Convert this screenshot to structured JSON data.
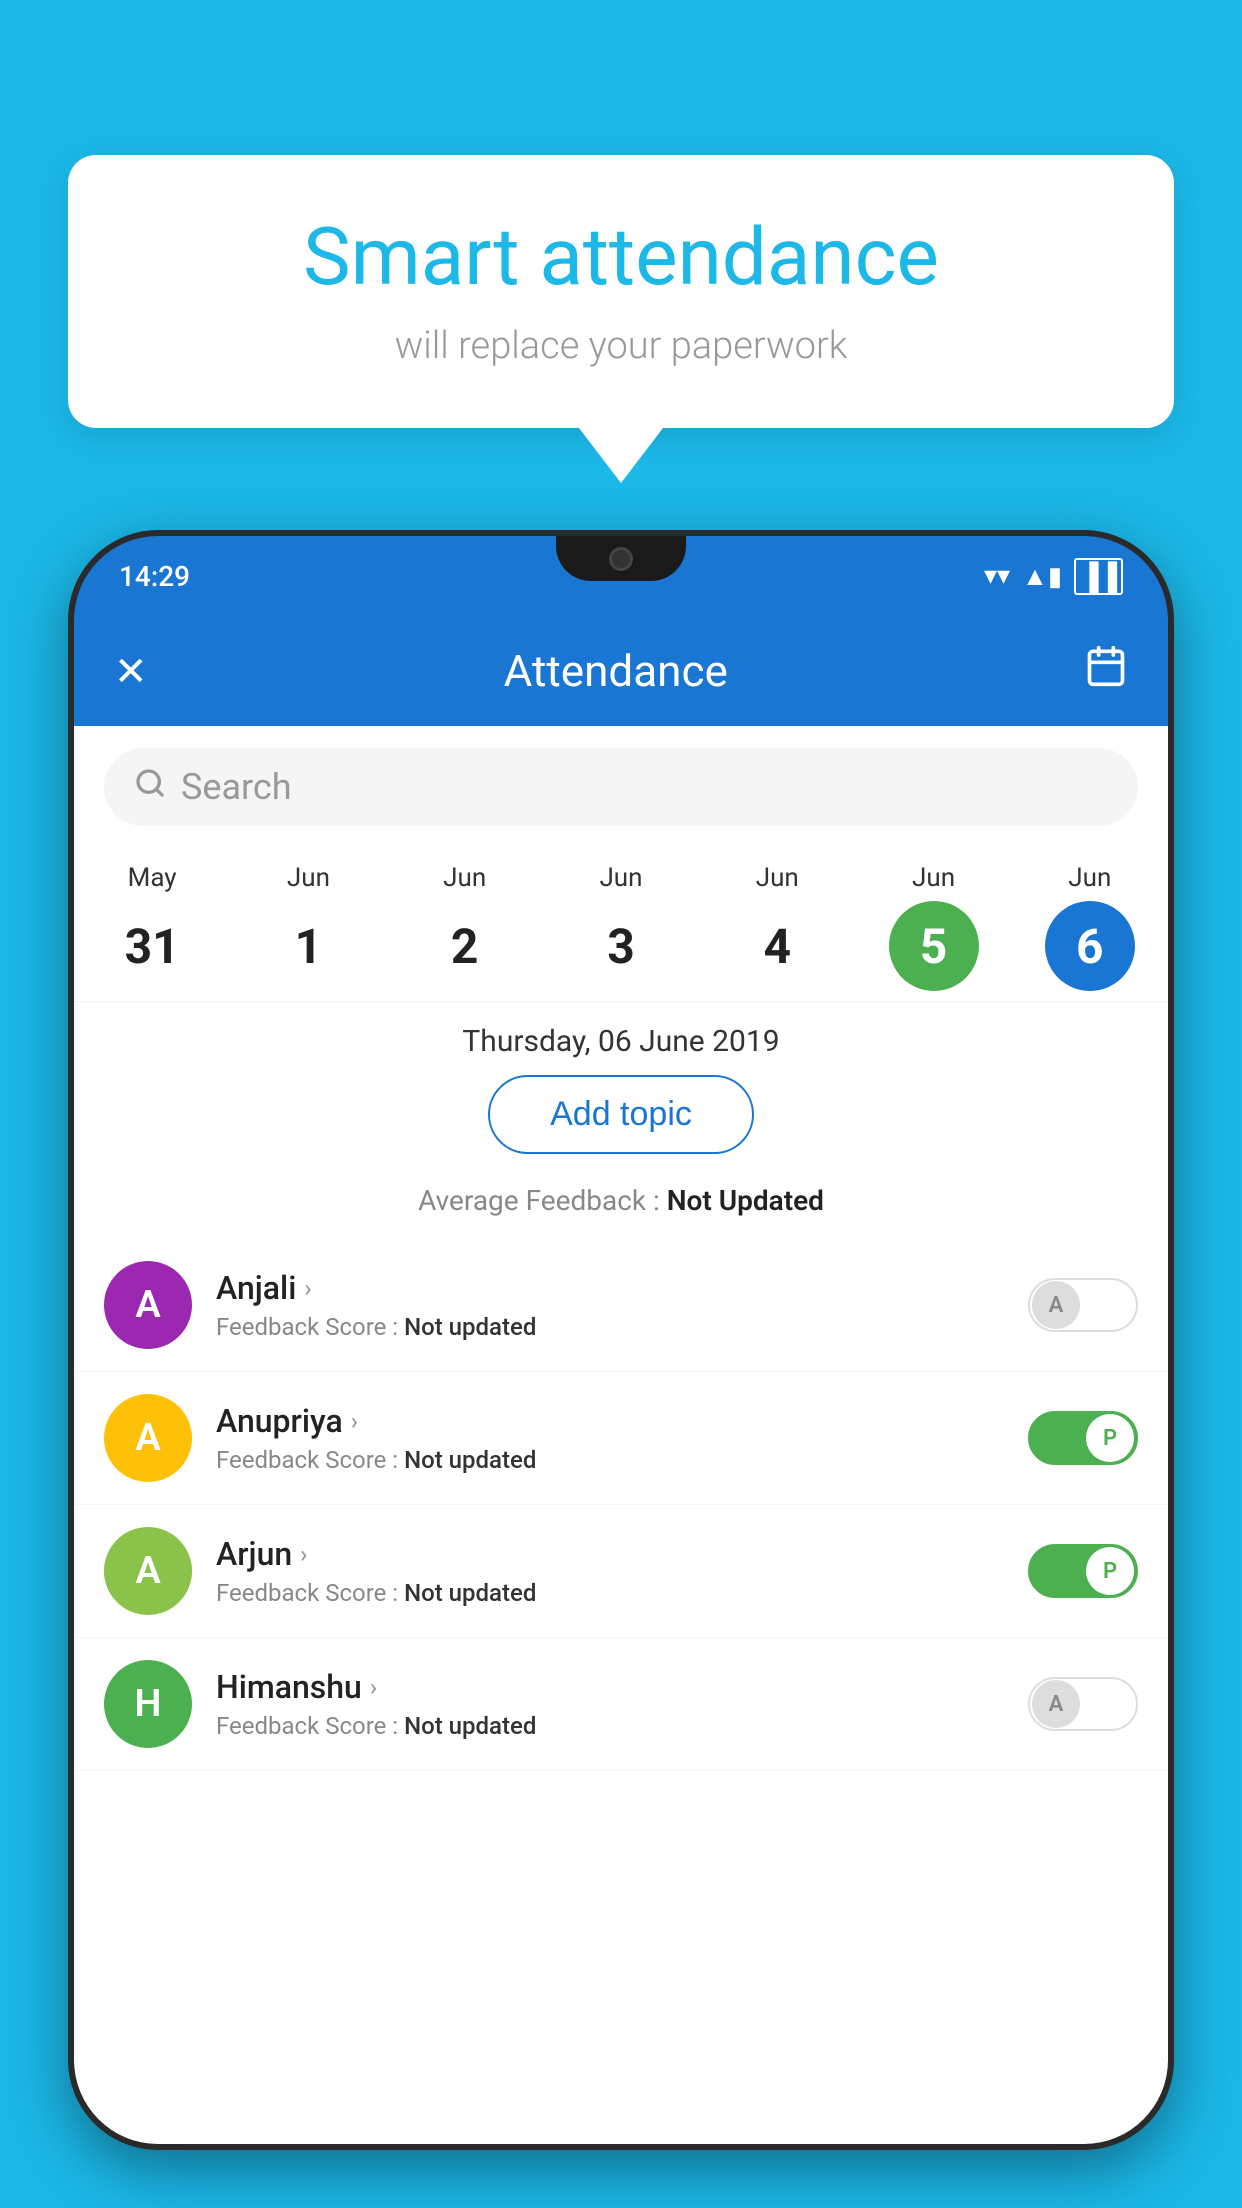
{
  "background_color": "#1BB8E8",
  "speech_bubble": {
    "title": "Smart attendance",
    "subtitle": "will replace your paperwork"
  },
  "phone": {
    "status_bar": {
      "time": "14:29",
      "wifi": "▼",
      "signal": "▲",
      "battery": "▐"
    },
    "app_bar": {
      "close_label": "✕",
      "title": "Attendance",
      "calendar_label": "📅"
    },
    "search": {
      "placeholder": "Search"
    },
    "calendar": {
      "days": [
        {
          "month": "May",
          "date": "31",
          "state": "normal"
        },
        {
          "month": "Jun",
          "date": "1",
          "state": "normal"
        },
        {
          "month": "Jun",
          "date": "2",
          "state": "normal"
        },
        {
          "month": "Jun",
          "date": "3",
          "state": "normal"
        },
        {
          "month": "Jun",
          "date": "4",
          "state": "normal"
        },
        {
          "month": "Jun",
          "date": "5",
          "state": "today"
        },
        {
          "month": "Jun",
          "date": "6",
          "state": "selected"
        }
      ]
    },
    "selected_date_label": "Thursday, 06 June 2019",
    "add_topic_label": "Add topic",
    "avg_feedback_label": "Average Feedback :",
    "avg_feedback_value": "Not Updated",
    "students": [
      {
        "name": "Anjali",
        "initial": "A",
        "avatar_color": "purple",
        "feedback_label": "Feedback Score :",
        "feedback_value": "Not updated",
        "toggle_state": "off",
        "toggle_letter": "A"
      },
      {
        "name": "Anupriya",
        "initial": "A",
        "avatar_color": "yellow",
        "feedback_label": "Feedback Score :",
        "feedback_value": "Not updated",
        "toggle_state": "on",
        "toggle_letter": "P"
      },
      {
        "name": "Arjun",
        "initial": "A",
        "avatar_color": "green-light",
        "feedback_label": "Feedback Score :",
        "feedback_value": "Not updated",
        "toggle_state": "on",
        "toggle_letter": "P"
      },
      {
        "name": "Himanshu",
        "initial": "H",
        "avatar_color": "green-dark",
        "feedback_label": "Feedback Score :",
        "feedback_value": "Not updated",
        "toggle_state": "off",
        "toggle_letter": "A"
      }
    ]
  }
}
